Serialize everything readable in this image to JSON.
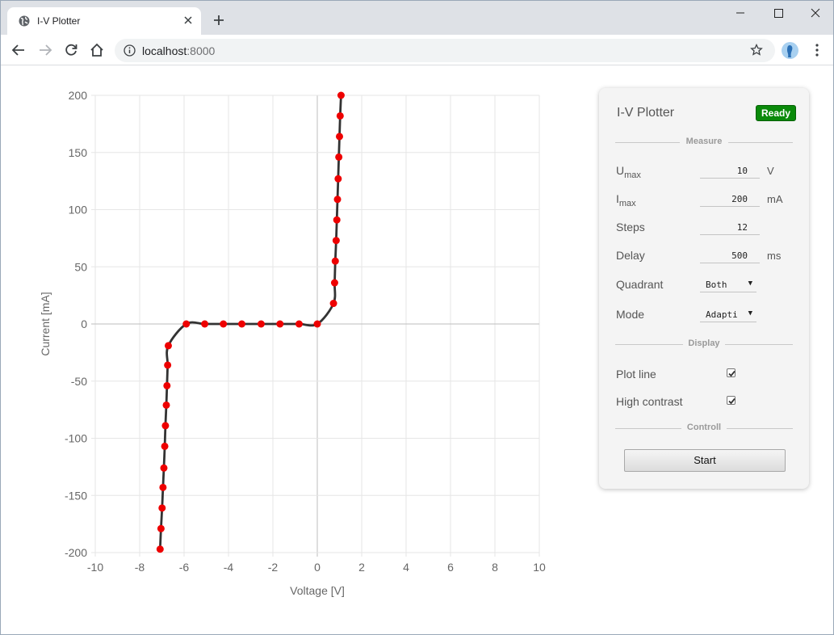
{
  "browser": {
    "tab_title": "I-V Plotter",
    "url_host": "localhost",
    "url_port": ":8000"
  },
  "panel": {
    "title": "I-V Plotter",
    "status": "Ready",
    "sections": {
      "measure": "Measure",
      "display": "Display",
      "control": "Controll"
    },
    "umax": {
      "label_main": "U",
      "label_sub": "max",
      "value": "10",
      "unit": "V"
    },
    "imax": {
      "label_main": "I",
      "label_sub": "max",
      "value": "200",
      "unit": "mA"
    },
    "steps": {
      "label": "Steps",
      "value": "12"
    },
    "delay": {
      "label": "Delay",
      "value": "500",
      "unit": "ms"
    },
    "quadrant": {
      "label": "Quadrant",
      "value": "Both"
    },
    "mode": {
      "label": "Mode",
      "value": "Adapti"
    },
    "plot_line": {
      "label": "Plot line",
      "checked": true
    },
    "high_contrast": {
      "label": "High contrast",
      "checked": true
    },
    "start_label": "Start"
  },
  "colors": {
    "status_green": "#0a8a0a",
    "point_red": "#ee0000",
    "line_dark": "#333333",
    "grid": "#e6e6e6"
  },
  "chart_data": {
    "type": "scatter",
    "xlabel": "Voltage [V]",
    "ylabel": "Current [mA]",
    "xlim": [
      -10,
      10
    ],
    "ylim": [
      -200,
      200
    ],
    "x_ticks": [
      -10,
      -8,
      -6,
      -4,
      -2,
      0,
      2,
      4,
      6,
      8,
      10
    ],
    "y_ticks": [
      200,
      150,
      100,
      50,
      0,
      -50,
      -100,
      -150,
      -200
    ],
    "grid": true,
    "series": [
      {
        "points": [
          [
            -7.08,
            -197
          ],
          [
            -7.04,
            -179
          ],
          [
            -6.99,
            -161
          ],
          [
            -6.95,
            -143
          ],
          [
            -6.91,
            -126
          ],
          [
            -6.87,
            -107
          ],
          [
            -6.84,
            -89
          ],
          [
            -6.8,
            -71
          ],
          [
            -6.77,
            -54
          ],
          [
            -6.74,
            -36
          ],
          [
            -6.71,
            -19
          ],
          [
            -5.9,
            0
          ],
          [
            -5.07,
            0
          ],
          [
            -4.23,
            0
          ],
          [
            -3.4,
            0
          ],
          [
            -2.53,
            0
          ],
          [
            -1.68,
            0
          ],
          [
            -0.82,
            0
          ],
          [
            0.0,
            0
          ],
          [
            0.73,
            18
          ],
          [
            0.78,
            36
          ],
          [
            0.81,
            55
          ],
          [
            0.85,
            73
          ],
          [
            0.88,
            91
          ],
          [
            0.91,
            109
          ],
          [
            0.94,
            127
          ],
          [
            0.97,
            146
          ],
          [
            1.0,
            164
          ],
          [
            1.03,
            182
          ],
          [
            1.07,
            200
          ]
        ]
      }
    ]
  }
}
